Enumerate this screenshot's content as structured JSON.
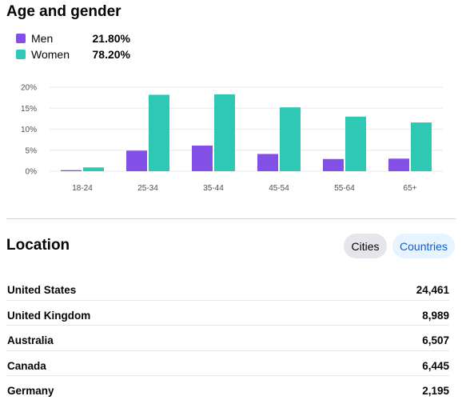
{
  "age_gender": {
    "title": "Age and gender",
    "legend": [
      {
        "label": "Men",
        "value": "21.80%",
        "color": "#8250e6"
      },
      {
        "label": "Women",
        "value": "78.20%",
        "color": "#2ec8b4"
      }
    ]
  },
  "chart_data": {
    "type": "bar",
    "title": "Age and gender",
    "xlabel": "",
    "ylabel": "",
    "categories": [
      "18-24",
      "25-34",
      "35-44",
      "45-54",
      "55-64",
      "65+"
    ],
    "series": [
      {
        "name": "Men",
        "color": "#8250e6",
        "values": [
          0.25,
          4.9,
          6.1,
          4.1,
          2.9,
          3.0
        ]
      },
      {
        "name": "Women",
        "color": "#2ec8b4",
        "values": [
          0.9,
          18.2,
          18.3,
          15.2,
          13.0,
          11.6
        ]
      }
    ],
    "ylim": [
      0,
      20
    ],
    "yticks": [
      0,
      5,
      10,
      15,
      20
    ],
    "ytick_labels": [
      "0%",
      "5%",
      "10%",
      "15%",
      "20%"
    ],
    "grid": true,
    "legend_position": "top-left"
  },
  "location": {
    "title": "Location",
    "toggles": [
      {
        "label": "Cities",
        "selected": false
      },
      {
        "label": "Countries",
        "selected": true
      }
    ],
    "rows": [
      {
        "name": "United States",
        "count": "24,461"
      },
      {
        "name": "United Kingdom",
        "count": "8,989"
      },
      {
        "name": "Australia",
        "count": "6,507"
      },
      {
        "name": "Canada",
        "count": "6,445"
      },
      {
        "name": "Germany",
        "count": "2,195"
      }
    ]
  }
}
